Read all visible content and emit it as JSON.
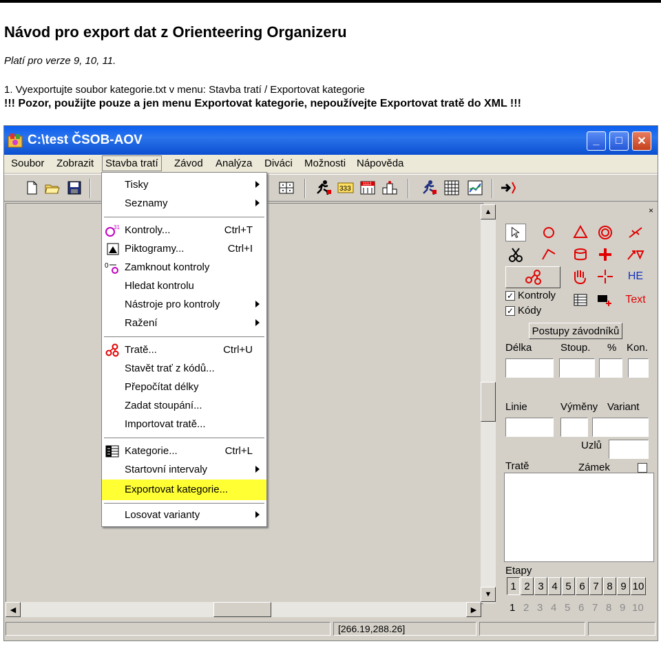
{
  "doc": {
    "title": "Návod pro export dat z Orienteering Organizeru",
    "version_note": "Platí pro verze 9, 10, 11.",
    "step1": "1. Vyexportujte soubor kategorie.txt v menu: Stavba tratí / Exportovat kategorie",
    "warning": "!!! Pozor, použijte pouze a jen menu Exportovat kategorie, nepoužívejte Exportovat tratě do XML !!!"
  },
  "window": {
    "title": "C:\\test   ČSOB-AOV",
    "controls": {
      "minimize": "_",
      "maximize": "□",
      "close": "✕"
    }
  },
  "menubar": [
    "Soubor",
    "Zobrazit",
    "Stavba tratí",
    "Závod",
    "Analýza",
    "Diváci",
    "Možnosti",
    "Nápověda"
  ],
  "toolbar": {
    "badge_333": "333",
    "badge_112": "1112"
  },
  "dropdown": {
    "items": [
      {
        "label": "Tisky",
        "shortcut": "",
        "submenu": true
      },
      {
        "label": "Seznamy",
        "shortcut": "",
        "submenu": true
      },
      {
        "label": "Kontroly...",
        "shortcut": "Ctrl+T",
        "submenu": false,
        "icon": "control-circle-icon",
        "icon_text": "31"
      },
      {
        "label": "Piktogramy...",
        "shortcut": "Ctrl+I",
        "submenu": false,
        "icon": "pictogram-icon"
      },
      {
        "label": "Zamknout kontroly",
        "shortcut": "",
        "submenu": false,
        "icon": "lock-controls-icon",
        "icon_text": "0"
      },
      {
        "label": "Hledat kontrolu",
        "shortcut": "",
        "submenu": false
      },
      {
        "label": "Nástroje pro kontroly",
        "shortcut": "",
        "submenu": true
      },
      {
        "label": "Ražení",
        "shortcut": "",
        "submenu": true
      },
      {
        "label": "Tratě...",
        "shortcut": "Ctrl+U",
        "submenu": false,
        "icon": "courses-icon"
      },
      {
        "label": "Stavět trať z kódů...",
        "shortcut": "",
        "submenu": false
      },
      {
        "label": "Přepočítat délky",
        "shortcut": "",
        "submenu": false
      },
      {
        "label": "Zadat stoupání...",
        "shortcut": "",
        "submenu": false
      },
      {
        "label": "Importovat tratě...",
        "shortcut": "",
        "submenu": false
      },
      {
        "label": "Kategorie...",
        "shortcut": "Ctrl+L",
        "submenu": false,
        "icon": "categories-icon"
      },
      {
        "label": "Startovní intervaly",
        "shortcut": "",
        "submenu": true
      },
      {
        "label": "Exportovat kategorie...",
        "shortcut": "",
        "submenu": false,
        "highlighted": true,
        "highlight_color": "#ffff33"
      },
      {
        "label": "Losovat varianty",
        "shortcut": "",
        "submenu": true
      }
    ]
  },
  "panel": {
    "close": "×",
    "he_label": "HE",
    "text_label": "Text",
    "chk_kontroly": "Kontroly",
    "chk_kody": "Kódy",
    "chk_kontroly_state": "✓",
    "chk_kody_state": "✓",
    "postupy_btn": "Postupy závodníků",
    "lbl_delka": "Délka",
    "lbl_stoup": "Stoup.",
    "lbl_pct": "%",
    "lbl_kon": "Kon.",
    "lbl_linie": "Linie",
    "lbl_vymeny": "Výměny",
    "lbl_variant": "Variant",
    "lbl_uzlu": "Uzlů",
    "lbl_trate": "Tratě",
    "lbl_zamek": "Zámek",
    "lbl_etapy": "Etapy",
    "etapy": [
      "1",
      "2",
      "3",
      "4",
      "5",
      "6",
      "7",
      "8",
      "9",
      "10"
    ],
    "etapy_nums": [
      "1",
      "2",
      "3",
      "4",
      "5",
      "6",
      "7",
      "8",
      "9",
      "10"
    ]
  },
  "status": {
    "coords": "[266.19,288.26]"
  },
  "colors": {
    "titlebar": "#0a5ef0",
    "highlight": "#ffff33",
    "accent_red": "#e00000"
  }
}
